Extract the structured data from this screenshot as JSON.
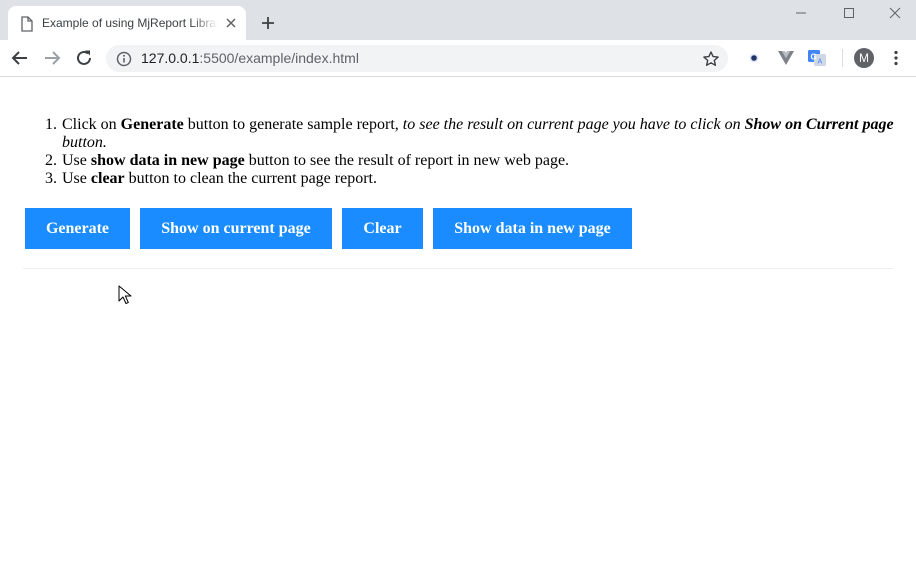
{
  "browser": {
    "tab": {
      "title": "Example of using MjReport Library"
    },
    "address": {
      "host": "127.0.0.1",
      "port_path": ":5500/example/index.html"
    },
    "profile_initial": "M",
    "icons": [
      "page-icon",
      "close-icon",
      "plus-icon",
      "minimize-icon",
      "maximize-icon",
      "window-close-icon",
      "back-arrow-icon",
      "forward-arrow-icon",
      "reload-icon",
      "info-icon",
      "star-icon",
      "eye-extension-icon",
      "vue-extension-icon",
      "translate-extension-icon",
      "menu-dots-icon"
    ]
  },
  "page": {
    "instructions": [
      {
        "num": "1.",
        "parts": [
          "Click on ",
          "Generate",
          " button to generate sample report, ",
          "to see the result on current page you have to click on ",
          "Show on Current page",
          " button."
        ]
      },
      {
        "num": "2.",
        "parts": [
          "Use ",
          "show data in new page",
          " button to see the result of report in new web page."
        ]
      },
      {
        "num": "3.",
        "parts": [
          "Use ",
          "clear",
          " button to clean the current page report."
        ]
      }
    ],
    "buttons": {
      "generate": "Generate",
      "show_current": "Show on current page",
      "clear": "Clear",
      "show_new": "Show data in new page"
    },
    "colors": {
      "button_bg": "#1a8cff",
      "button_text": "#ffffff"
    }
  }
}
